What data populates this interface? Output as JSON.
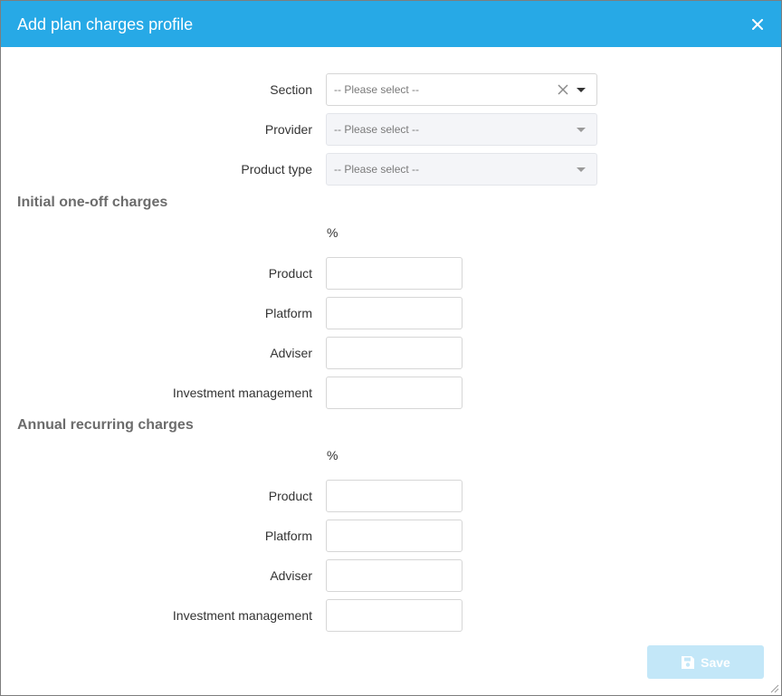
{
  "dialog": {
    "title": "Add plan charges profile",
    "close_icon": "close-icon"
  },
  "selects": {
    "section": {
      "label": "Section",
      "placeholder": "-- Please select --",
      "disabled": false
    },
    "provider": {
      "label": "Provider",
      "placeholder": "-- Please select --",
      "disabled": true
    },
    "product_type": {
      "label": "Product type",
      "placeholder": "-- Please select --",
      "disabled": true
    }
  },
  "initial": {
    "heading": "Initial one-off charges",
    "unit": "%",
    "fields": [
      {
        "label": "Product",
        "value": ""
      },
      {
        "label": "Platform",
        "value": ""
      },
      {
        "label": "Adviser",
        "value": ""
      },
      {
        "label": "Investment management",
        "value": ""
      }
    ]
  },
  "annual": {
    "heading": "Annual recurring charges",
    "unit": "%",
    "fields": [
      {
        "label": "Product",
        "value": ""
      },
      {
        "label": "Platform",
        "value": ""
      },
      {
        "label": "Adviser",
        "value": ""
      },
      {
        "label": "Investment management",
        "value": ""
      }
    ]
  },
  "footer": {
    "save_label": "Save",
    "save_icon": "save-icon"
  },
  "colors": {
    "titlebar": "#27a9e6",
    "save_disabled": "#c3e7f8"
  }
}
